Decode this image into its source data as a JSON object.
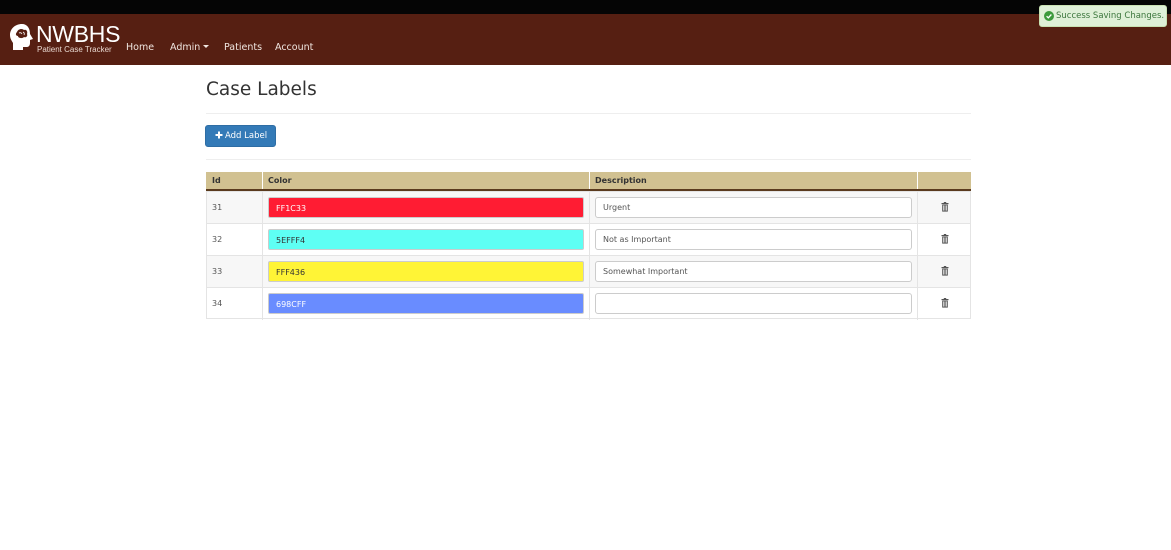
{
  "colors": {
    "navbar": "#561f12",
    "topbar": "#050505",
    "table_header": "#d1c191",
    "primary_button": "#337ab7",
    "toast_bg": "#dff0d8",
    "toast_text": "#3c763d"
  },
  "brand": {
    "name": "NWBHS",
    "subtitle": "Patient Case Tracker",
    "icon": "head-brain-logo-icon"
  },
  "nav": {
    "items": [
      {
        "label": "Home"
      },
      {
        "label": "Admin",
        "dropdown": true
      },
      {
        "label": "Patients"
      },
      {
        "label": "Account"
      }
    ]
  },
  "toast": {
    "icon": "check-circle-icon",
    "text": "Success Saving Changes."
  },
  "page": {
    "title": "Case Labels",
    "add_button": {
      "icon": "plus-icon",
      "label": "Add Label"
    }
  },
  "table": {
    "headers": {
      "id": "Id",
      "color": "Color",
      "description": "Description"
    },
    "rows": [
      {
        "id": "31",
        "color": "FF1C33",
        "color_hex": "#ff1c33",
        "text_color": "#ffffff",
        "description": "Urgent",
        "delete_icon": "trash-icon"
      },
      {
        "id": "32",
        "color": "5EFFF4",
        "color_hex": "#5efff4",
        "text_color": "#333333",
        "description": "Not as Important",
        "delete_icon": "trash-icon"
      },
      {
        "id": "33",
        "color": "FFF436",
        "color_hex": "#fff436",
        "text_color": "#333333",
        "description": "Somewhat Important",
        "delete_icon": "trash-icon"
      },
      {
        "id": "34",
        "color": "698CFF",
        "color_hex": "#698cff",
        "text_color": "#ffffff",
        "description": "",
        "delete_icon": "trash-icon"
      }
    ]
  }
}
